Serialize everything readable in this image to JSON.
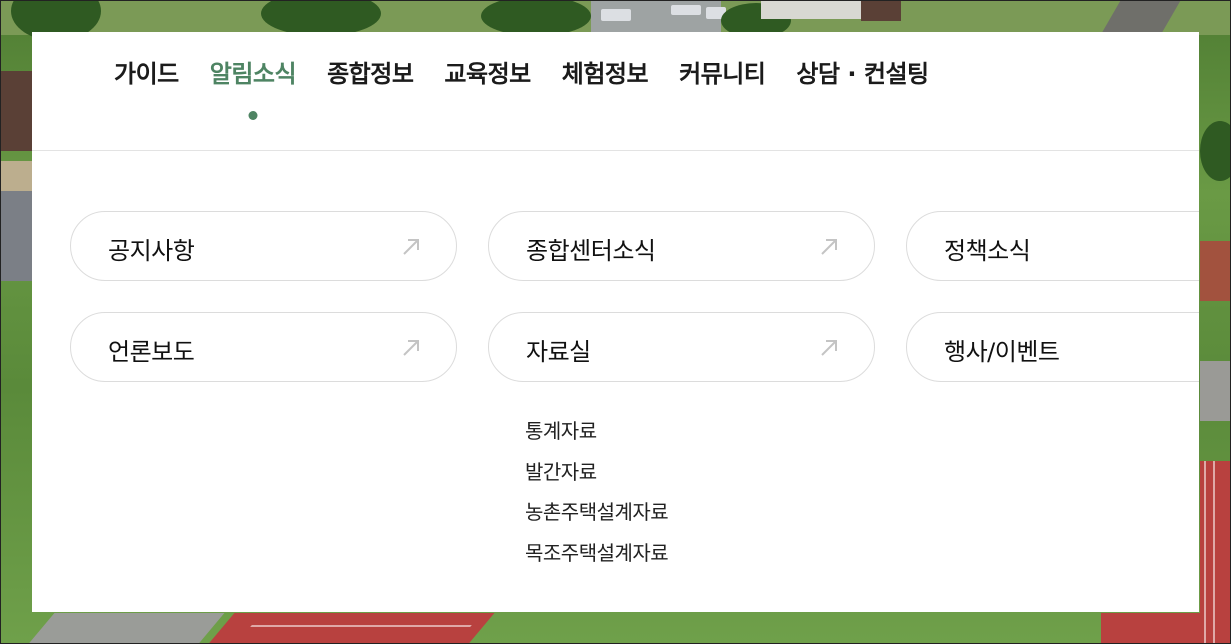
{
  "nav": {
    "items": [
      {
        "label": "가이드"
      },
      {
        "label": "알림소식"
      },
      {
        "label": "종합정보"
      },
      {
        "label": "교육정보"
      },
      {
        "label": "체험정보"
      },
      {
        "label": "커뮤니티"
      },
      {
        "label": "상담 · 컨설팅"
      }
    ],
    "active_index": 1
  },
  "cards": [
    {
      "label": "공지사항",
      "icon": "arrow-up-right-icon"
    },
    {
      "label": "종합센터소식",
      "icon": "arrow-up-right-icon"
    },
    {
      "label": "정책소식",
      "icon": "arrow-up-right-icon"
    },
    {
      "label": "언론보도",
      "icon": "arrow-up-right-icon"
    },
    {
      "label": "자료실",
      "icon": "arrow-up-right-icon"
    },
    {
      "label": "행사/이벤트",
      "icon": "arrow-up-right-icon"
    }
  ],
  "submenu": {
    "items": [
      {
        "label": "통계자료"
      },
      {
        "label": "발간자료"
      },
      {
        "label": "농촌주택설계자료"
      },
      {
        "label": "목조주택설계자료"
      }
    ]
  },
  "colors": {
    "accent": "#4e8463",
    "text": "#1b1b1b",
    "card_border": "#dcdcdc",
    "arrow": "#c4c4c4"
  }
}
